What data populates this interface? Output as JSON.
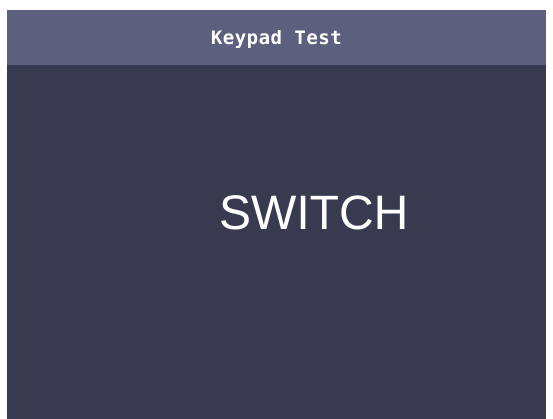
{
  "header": {
    "title": "Keypad Test"
  },
  "main": {
    "pressed_key": "SWITCH"
  },
  "colors": {
    "background": "#383b50",
    "title_bar": "#5c5f7d",
    "text": "#ffffff"
  }
}
